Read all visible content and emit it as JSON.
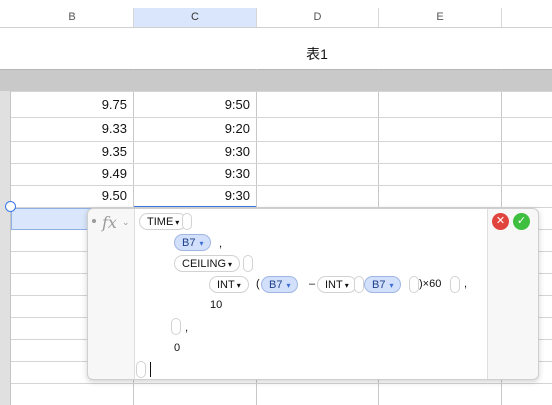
{
  "columns": [
    {
      "id": "B",
      "label": "B"
    },
    {
      "id": "C",
      "label": "C"
    },
    {
      "id": "D",
      "label": "D"
    },
    {
      "id": "E",
      "label": "E"
    }
  ],
  "table": {
    "title": "表1",
    "rows": [
      {
        "b": "9.75",
        "c": "9:50"
      },
      {
        "b": "9.33",
        "c": "9:20"
      },
      {
        "b": "9.35",
        "c": "9:30"
      },
      {
        "b": "9.49",
        "c": "9:30"
      },
      {
        "b": "9.50",
        "c": "9:30"
      }
    ]
  },
  "formula_editor": {
    "fx_label": "fx",
    "func_time": "TIME",
    "arg_ref_1": "B7",
    "comma": ",",
    "func_ceiling": "CEILING",
    "func_int_1": "INT",
    "open_paren": "(",
    "arg_ref_2": "B7",
    "minus": "–",
    "func_int_2": "INT",
    "arg_ref_3": "B7",
    "times_60": ")×60",
    "significance": "10",
    "seconds": "0",
    "cancel_glyph": "✕",
    "accept_glyph": "✓",
    "accent_cancel": "#e0443e",
    "accent_accept": "#3fbf3f",
    "ref_color": "#d3e0fb",
    "dropdown_arrow": "▾"
  }
}
